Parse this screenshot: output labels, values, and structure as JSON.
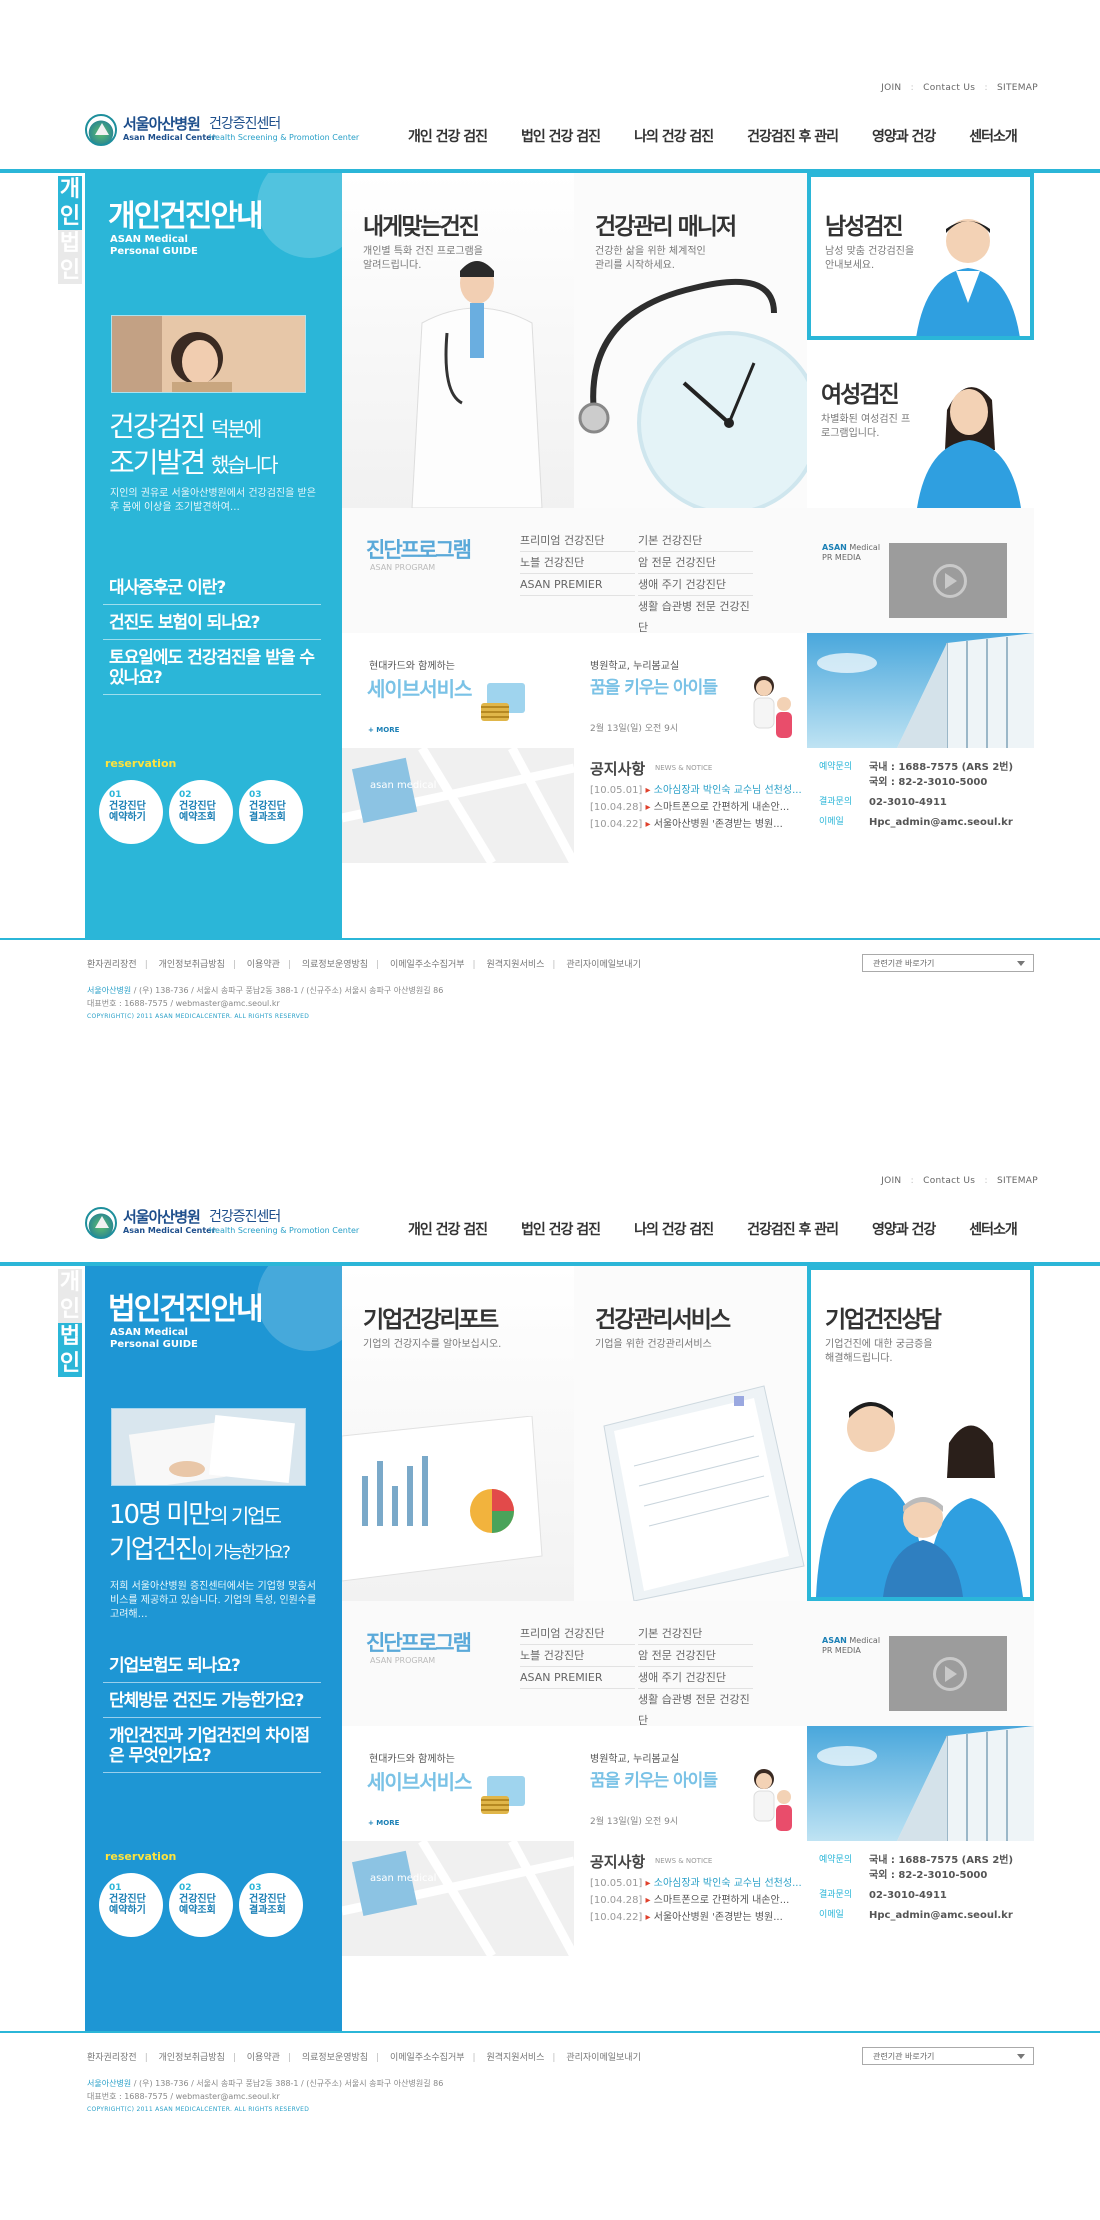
{
  "util": {
    "join": "JOIN",
    "contact": "Contact Us",
    "sitemap": "SITEMAP",
    "sep": ":"
  },
  "logo": {
    "name_ko": "서울아산병원",
    "center_ko": "건강증진센터",
    "name_en": "Asan Medical Center",
    "center_en": "Health Screening & Promotion Center"
  },
  "gnb": [
    "개인 건강 검진",
    "법인 건강 검진",
    "나의 건강 검진",
    "건강검진 후 관리",
    "영양과 건강",
    "센터소개"
  ],
  "accent_color": "#2bb6d8",
  "personal": {
    "side_tab_a": "개인",
    "side_tab_b": "법인",
    "title": "개인건진안내",
    "sub1": "ASAN Medical",
    "sub2": "Personal GUIDE",
    "big1": "건강검진",
    "big1s": "덕분에",
    "big2": "조기발견",
    "big2s": "했습니다",
    "desc": "지인의 권유로 서울아산병원에서 건강검진을 받은후 몸에 이상을 조기발견하여…",
    "links": [
      "대사증후군 이란?",
      "건진도 보험이 되나요?",
      "토요일에도 건강검진을 받을 수 있나요?"
    ],
    "tiles": [
      {
        "title": "내게맞는건진",
        "desc": "개인별 특화 건진 프로그램을 알려드립니다."
      },
      {
        "title": "건강관리 매니저",
        "desc": "건강한 삶을 위한 체계적인 관리를 시작하세요."
      },
      {
        "title": "남성검진",
        "desc": "남성 맞춤 건강검진을 안내보세요."
      },
      {
        "title": "여성검진",
        "desc": "차별화된 여성검진 프로그램입니다."
      }
    ]
  },
  "corporate": {
    "side_tab_a": "개인",
    "side_tab_b": "법인",
    "title": "법인건진안내",
    "sub1": "ASAN Medical",
    "sub2": "Personal GUIDE",
    "big1": "10명 미만",
    "big1s": "의 기업도",
    "big2": "기업건진",
    "big2s": "이 가능한가요?",
    "desc": "저희 서울아산병원 증진센터에서는 기업형 맞춤서비스를 제공하고 있습니다. 기업의 특성, 인원수를 고려해…",
    "links": [
      "기업보험도 되나요?",
      "단체방문 건진도 가능한가요?",
      "개인건진과 기업건진의 차이점은 무엇인가요?"
    ],
    "tiles": [
      {
        "title": "기업건강리포트",
        "desc": "기업의 건강지수를 알아보십시오."
      },
      {
        "title": "건강관리서비스",
        "desc": "기업을 위한 건강관리서비스"
      },
      {
        "title": "기업건진상담",
        "desc": "기업건진에 대한 궁금증을 해결해드립니다."
      }
    ]
  },
  "reservation": {
    "label": "reservation",
    "items": [
      {
        "num": "01",
        "l1": "건강진단",
        "l2": "예약하기"
      },
      {
        "num": "02",
        "l1": "건강진단",
        "l2": "예약조회"
      },
      {
        "num": "03",
        "l1": "건강진단",
        "l2": "결과조회"
      }
    ]
  },
  "program": {
    "title": "진단프로그램",
    "sub": "ASAN PROGRAM",
    "col1": [
      "프리미엄 건강진단",
      "노블 건강진단",
      "ASAN PREMIER"
    ],
    "col2": [
      "기본 건강진단",
      "암 전문 건강진단",
      "생애 주기 건강진단",
      "생활 습관병 전문 건강진단"
    ]
  },
  "pr": {
    "l1": "ASAN",
    "l1b": "Medical",
    "l2": "PR MEDIA"
  },
  "save": {
    "s1": "현대카드와 함께하는",
    "s2": "세이브서비스",
    "more": "+ MORE"
  },
  "school": {
    "s1": "병원학교, 누리봄교실",
    "s2": "꿈을 키우는 아이들",
    "date": "2월 13일(일) 오전 9시"
  },
  "map_label": "asan medical",
  "notice": {
    "title": "공지사항",
    "sub": "NEWS & NOTICE",
    "items": [
      {
        "date": "[10.05.01]",
        "text": "소아심장과 박인숙 교수님 선천성...",
        "hl": true
      },
      {
        "date": "[10.04.28]",
        "text": "스마트폰으로 간편하게 내손안...",
        "hl": false
      },
      {
        "date": "[10.04.22]",
        "text": "서울아산병원 '존경받는 병원...",
        "hl": false
      }
    ]
  },
  "contact": [
    {
      "k": "예약문의",
      "v": "국내 : 1688-7575 (ARS 2번)"
    },
    {
      "k": "",
      "v": "국외 : 82-2-3010-5000"
    },
    {
      "k": "결과문의",
      "v": "02-3010-4911"
    },
    {
      "k": "이메일",
      "v": "Hpc_admin@amc.seoul.kr"
    }
  ],
  "footer": {
    "nav": [
      "환자권리장전",
      "개인정보취급방침",
      "이용약관",
      "의료정보운영방침",
      "이메일주소수집거부",
      "원격지원서비스",
      "관리자이메일보내기"
    ],
    "select": "관련기관 바로가기",
    "addr_hosp": "서울아산병원",
    "addr": "/ (우) 138-736 / 서울시 송파구 풍납2동 388-1 / (신규주소) 서울시 송파구 아산병원길 86",
    "tel": "대표번호 : 1688-7575 / webmaster@amc.seoul.kr",
    "copy": "COPYRIGHT(C) 2011 ASAN MEDICALCENTER. ALL RIGHTS RESERVED"
  }
}
